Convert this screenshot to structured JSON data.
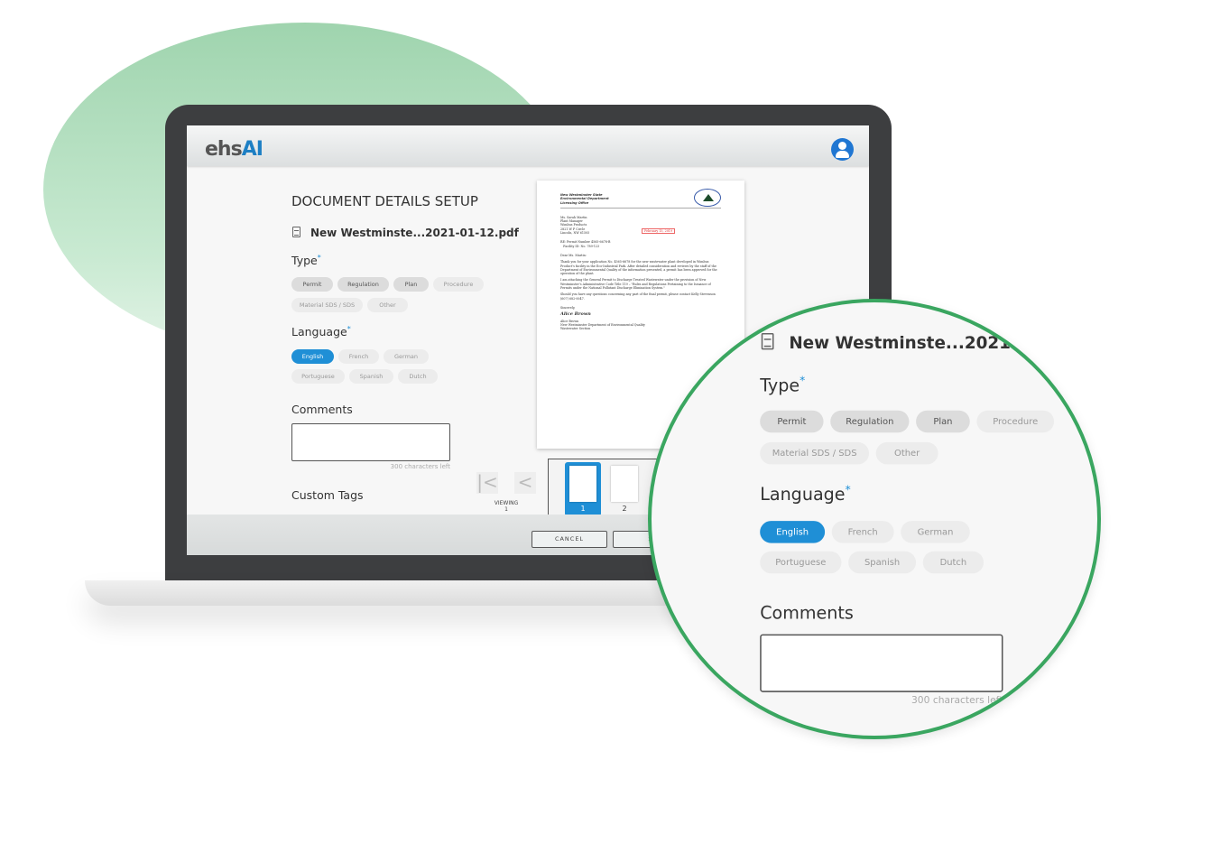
{
  "app": {
    "logo": "ehsAI",
    "logo_part1": "ehs",
    "logo_part2": "AI"
  },
  "page": {
    "title": "DOCUMENT DETAILS SETUP",
    "filename": "New Westminste...2021-01-12.pdf"
  },
  "type": {
    "label": "Type",
    "required": "*",
    "options": [
      {
        "label": "Permit",
        "state": "available"
      },
      {
        "label": "Regulation",
        "state": "available"
      },
      {
        "label": "Plan",
        "state": "available"
      },
      {
        "label": "Procedure",
        "state": "disabled"
      },
      {
        "label": "Material SDS / SDS",
        "state": "disabled"
      },
      {
        "label": "Other",
        "state": "disabled"
      }
    ]
  },
  "language": {
    "label": "Language",
    "required": "*",
    "options": [
      {
        "label": "English",
        "state": "selected"
      },
      {
        "label": "French",
        "state": "disabled"
      },
      {
        "label": "German",
        "state": "disabled"
      },
      {
        "label": "Portuguese",
        "state": "disabled"
      },
      {
        "label": "Spanish",
        "state": "disabled"
      },
      {
        "label": "Dutch",
        "state": "disabled"
      }
    ]
  },
  "comments": {
    "label": "Comments",
    "value": "",
    "counter": "300 characters left"
  },
  "custom_tags": {
    "label": "Custom Tags"
  },
  "viewer": {
    "viewing_label": "VIEWING",
    "current_page": "1",
    "thumbnails": [
      "1",
      "2"
    ]
  },
  "footer": {
    "cancel": "CANCEL",
    "save": "S"
  },
  "document": {
    "header": [
      "New Westminster State",
      "Environmental Department",
      "Licensing Office"
    ],
    "date": "February 15, 2019",
    "address": [
      "Ms. Sarah Martin",
      "Plant Manager",
      "Wimbus Products",
      "2821 W P Circle",
      "Lincoln, NW 61505"
    ],
    "re": [
      "RE: Permit Number 4565-6678-B",
      "Facility ID: No. 789-123"
    ],
    "salutation": "Dear Ms. Martin:",
    "paragraphs": [
      "Thank you for your application No. 4565-6678 for the new wastewater plant developed in Wimbus Product's facility in the Eco-Industrial Park. After detailed consideration and reviews by the staff of the Department of Environmental Quality of the information presented, a permit has been approved for the operation of the plant.",
      "I am attaching the General Permit to Discharge Treated Wastewater under the provision of New Westminster's Administrative Code Title 119 – \"Rules and Regulations Pertaining to the Issuance of Permits under the National Pollutant Discharge Elimination System.\"",
      "Should you have any questions concerning any part of the final permit, please contact Kelly Stevenson (607) 682-0047."
    ],
    "closing": "Sincerely,",
    "signature": "Alice Brown",
    "signer": [
      "Alice Brown",
      "New Westminster Department of Environmental Quality",
      "Wastewater Section"
    ]
  },
  "colors": {
    "accent": "#1f8fd6",
    "magnifier_ring": "#3aa660",
    "bezel": "#3d3e40",
    "blob": "#a8d9b5"
  }
}
